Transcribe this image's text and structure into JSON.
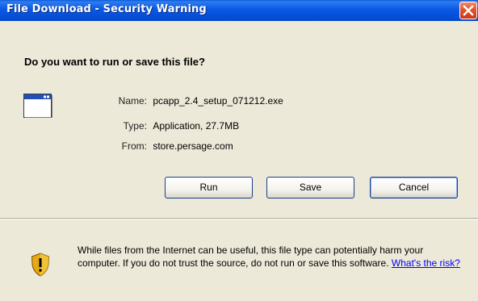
{
  "window": {
    "title": "File Download - Security Warning"
  },
  "dialog": {
    "prompt": "Do you want to run or save this file?",
    "file": {
      "name_label": "Name:",
      "name_value": "pcapp_2.4_setup_071212.exe",
      "type_label": "Type:",
      "type_value": "Application, 27.7MB",
      "from_label": "From:",
      "from_value": "store.persage.com"
    },
    "buttons": {
      "run": "Run",
      "save": "Save",
      "cancel": "Cancel"
    },
    "warning": {
      "text": "While files from the Internet can be useful, this file type can potentially harm your computer. If you do not trust the source, do not run or save this software.",
      "link": "What's the risk?"
    }
  },
  "icons": {
    "file": "application-window-icon",
    "warning": "security-shield-icon",
    "close": "close-icon"
  },
  "colors": {
    "titlebar": "#0d5ce6",
    "close": "#e2542c",
    "dialog_bg": "#ece9d8",
    "link": "#0000ff"
  }
}
